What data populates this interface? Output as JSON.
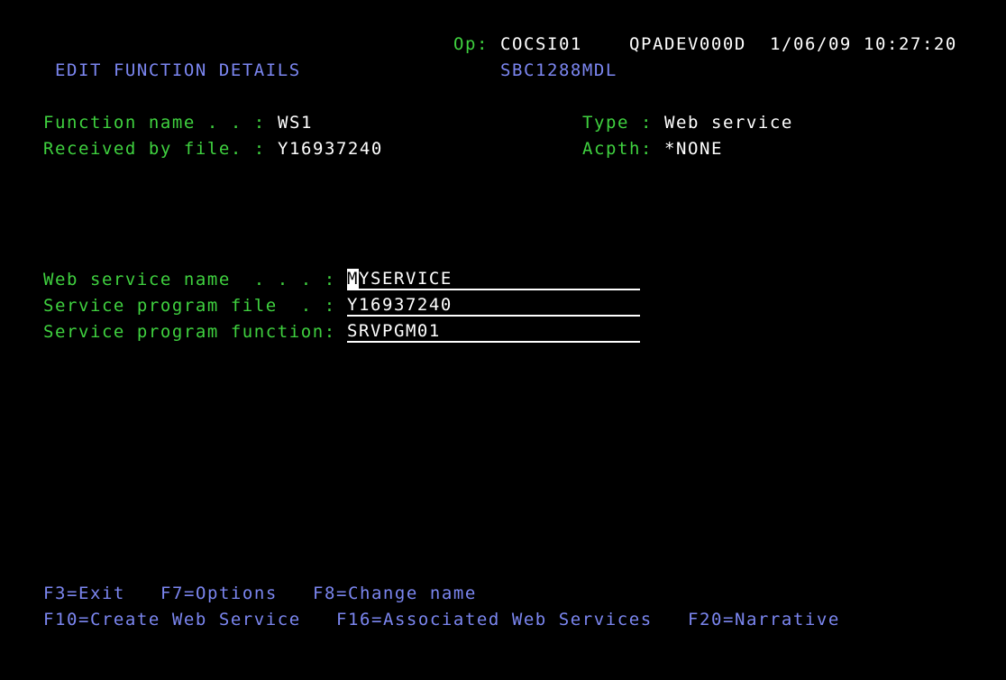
{
  "header": {
    "op_label": "Op:",
    "op_user": "COCSI01",
    "device": "QPADEV000D",
    "date": "1/06/09",
    "time": "10:27:20",
    "title": "EDIT FUNCTION DETAILS",
    "model": "SBC1288MDL"
  },
  "info": {
    "function_name_label": "Function name . . :",
    "function_name_value": "WS1",
    "received_by_file_label": "Received by file. :",
    "received_by_file_value": "Y16937240",
    "type_label": "Type :",
    "type_value": "Web service",
    "acpth_label": "Acpth:",
    "acpth_value": "*NONE"
  },
  "form": {
    "web_service_name_label": "Web service name  . . . :",
    "web_service_name_cursor_char": "M",
    "web_service_name_rest": "YSERVICE",
    "service_program_file_label": "Service program file  . :",
    "service_program_file_value": "Y16937240",
    "service_program_function_label": "Service program function:",
    "service_program_function_value": "SRVPGM01"
  },
  "function_keys": {
    "f3": "F3=Exit",
    "f7": "F7=Options",
    "f8": "F8=Change name",
    "f10": "F10=Create Web Service",
    "f16": "F16=Associated Web Services",
    "f20": "F20=Narrative"
  },
  "colors": {
    "background": "#000000",
    "label_green": "#3fd13f",
    "value_white": "#ffffff",
    "title_blue": "#7b86f0"
  }
}
